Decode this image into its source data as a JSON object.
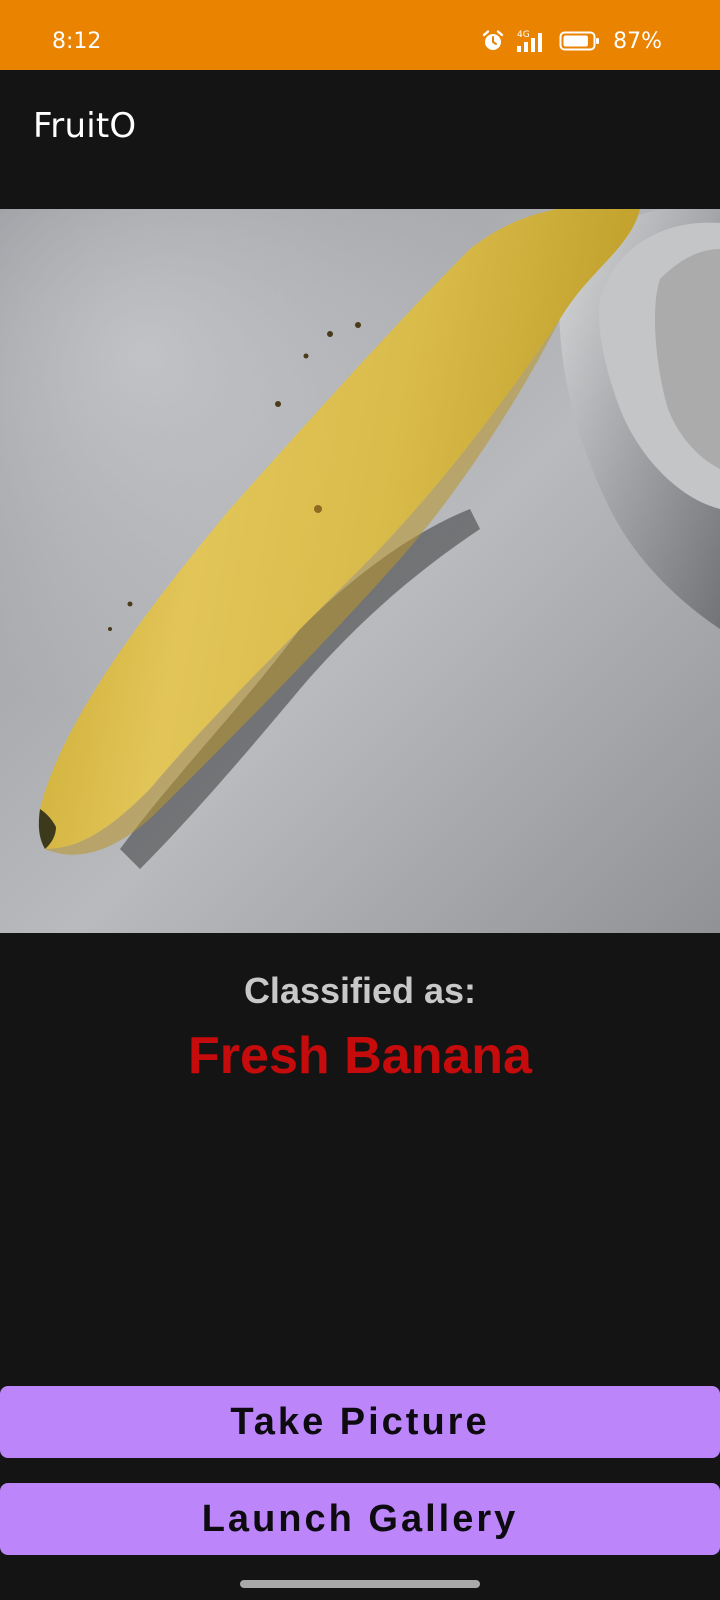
{
  "status_bar": {
    "time": "8:12",
    "network_label": "4G",
    "battery_percent": "87%",
    "battery_level": 0.87,
    "icons": [
      "alarm-clock-icon",
      "signal-4g-icon",
      "battery-icon"
    ]
  },
  "app_bar": {
    "title": "FruitO"
  },
  "photo": {
    "subject": "banana-photo"
  },
  "result": {
    "label": "Classified as:",
    "value": "Fresh Banana",
    "value_color": "#c50b0b"
  },
  "buttons": {
    "take_picture": "Take Picture",
    "launch_gallery": "Launch Gallery",
    "color": "#bc85fa"
  },
  "colors": {
    "status_bar": "#ea8300",
    "background": "#151415"
  }
}
